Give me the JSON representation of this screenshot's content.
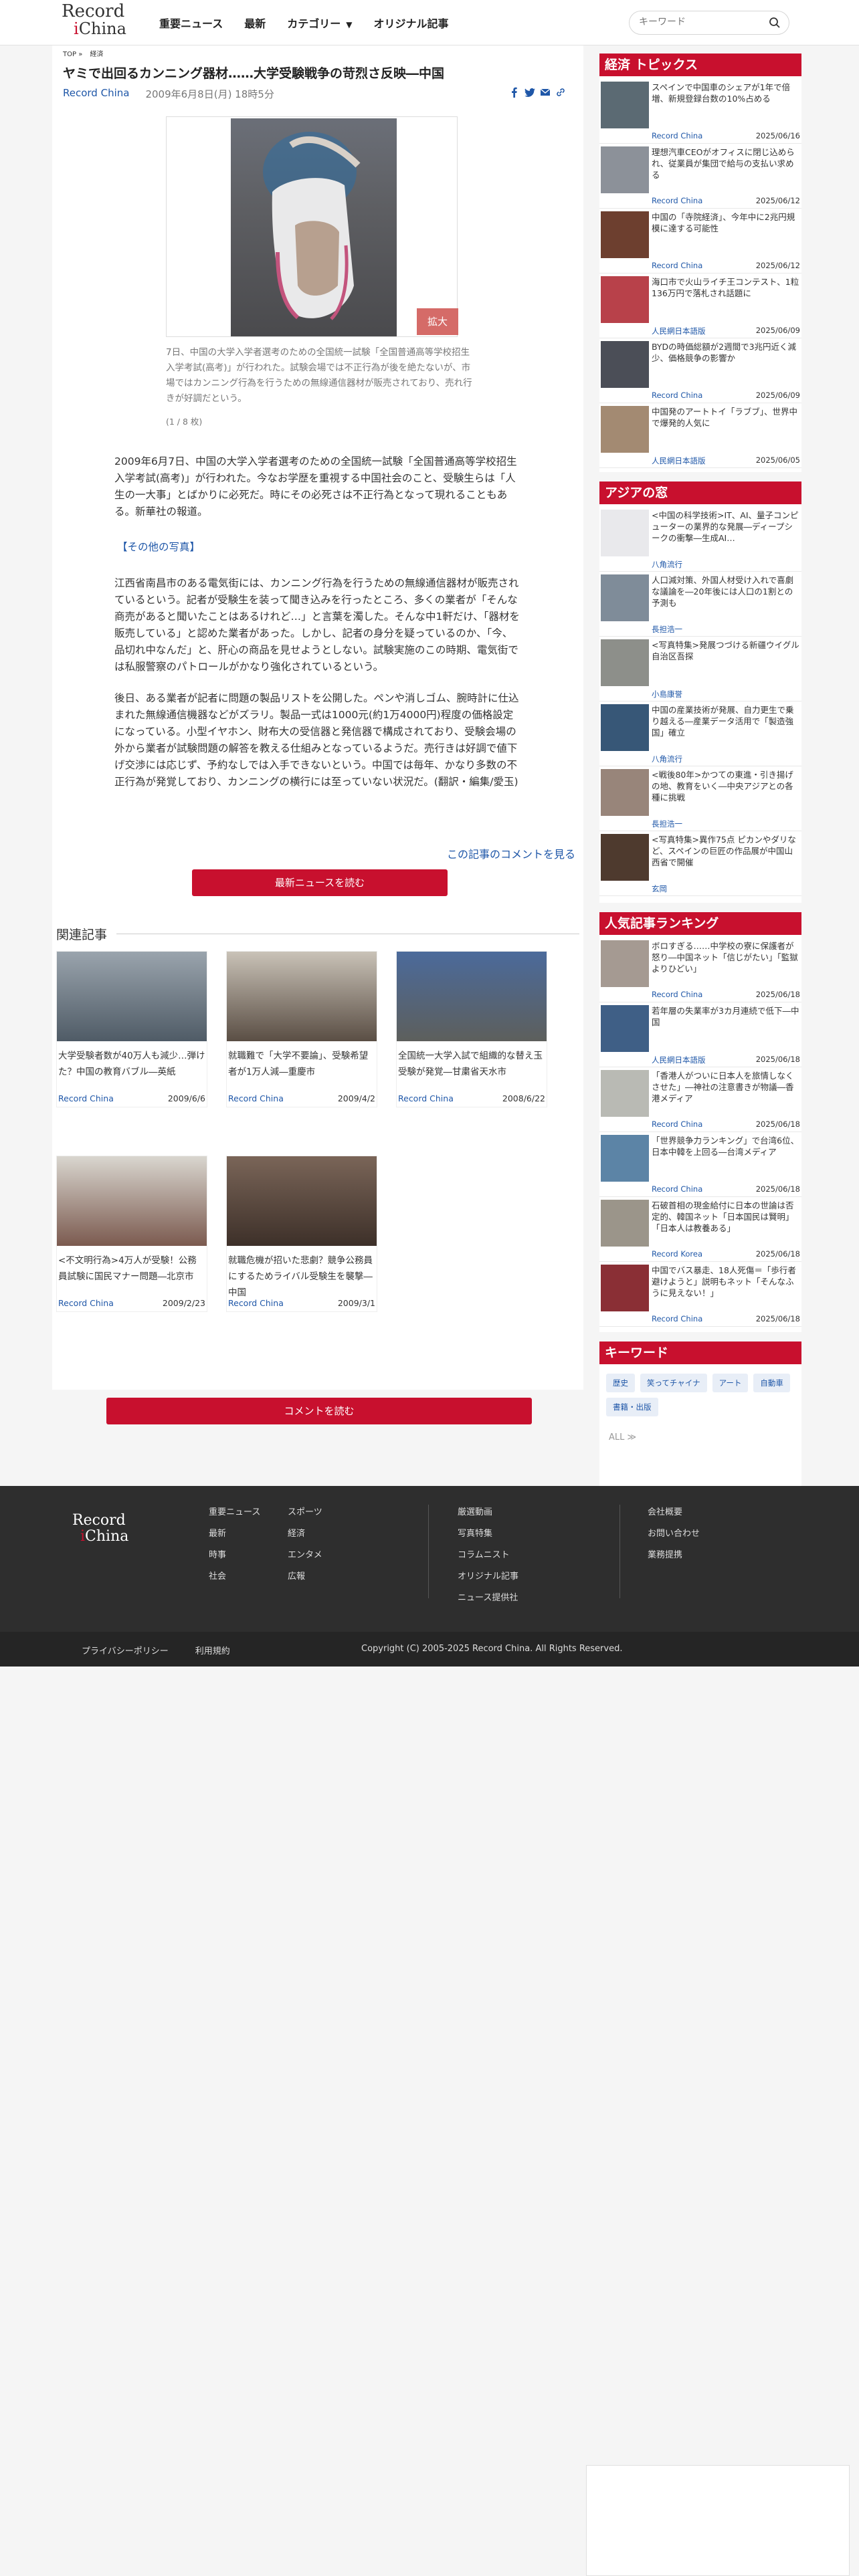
{
  "header": {
    "logo_line1": "Record",
    "logo_line2": "China",
    "nav": [
      "重要ニュース",
      "最新",
      "カテゴリー",
      "オリジナル記事"
    ],
    "search_placeholder": "キーワード"
  },
  "article": {
    "breadcrumb": [
      "TOP",
      "»",
      "経済"
    ],
    "title": "ヤミで出回るカンニング器材……大学受験戦争の苛烈さ反映―中国",
    "source": "Record China",
    "date": "2009年6月8日(月) 18時5分",
    "expand_label": "拡大",
    "caption": "7日、中国の大学入学者選考のための全国統一試験「全国普通高等学校招生入学考試(高考)」が行われた。試験会場では不正行為が後を絶たないが、市場ではカンニング行為を行うための無線通信器材が販売されており、売れ行きが好調だという。",
    "photo_count": "(1 / 8 枚)",
    "paragraph1": "2009年6月7日、中国の大学入学者選考のための全国統一試験「全国普通高等学校招生入学考試(高考)」が行われた。今なお学歴を重視する中国社会のこと、受験生らは「人生の一大事」とばかりに必死だ。時にその必死さは不正行為となって現れることもある。新華社の報道。",
    "photos_link": "【その他の写真】",
    "paragraph2": "江西省南昌市のある電気街には、カンニング行為を行うための無線通信器材が販売されているという。記者が受験生を装って聞き込みを行ったところ、多くの業者が「そんな商売があると聞いたことはあるけれど…」と言葉を濁した。そんな中1軒だけ、「器材を販売している」と認めた業者があった。しかし、記者の身分を疑っているのか、「今、品切れ中なんだ」と、肝心の商品を見せようとしない。試験実施のこの時期、電気街では私服警察のパトロールがかなり強化されているという。",
    "paragraph3": "後日、ある業者が記者に問題の製品リストを公開した。ペンや消しゴム、腕時計に仕込まれた無線通信機器などがズラリ。製品一式は1000元(約1万4000円)程度の価格設定になっている。小型イヤホン、財布大の受信器と発信器で構成されており、受験会場の外から業者が試験問題の解答を教える仕組みとなっているようだ。売行きは好調で値下げ交渉には応じず、予約なしでは入手できないという。中国では毎年、かなり多数の不正行為が発覚しており、カンニングの横行には至っていない状況だ。(翻訳・編集/愛玉)",
    "comment_link": "この記事のコメントを見る",
    "latest_button": "最新ニュースを読む"
  },
  "related": {
    "heading": "関連記事",
    "items": [
      {
        "title": "大学受験者数が40万人も減少…弾けた？中国の教育バブル―英紙",
        "source": "Record China",
        "date": "2009/6/6"
      },
      {
        "title": "就職難で「大学不要論」、受験希望者が1万人減―重慶市",
        "source": "Record China",
        "date": "2009/4/2"
      },
      {
        "title": "全国統一大学入試で組織的な替え玉受験が発覚―甘粛省天水市",
        "source": "Record China",
        "date": "2008/6/22"
      },
      {
        "title": "<不文明行為>4万人が受験！公務員試験に国民マナー問題―北京市",
        "source": "Record China",
        "date": "2009/2/23"
      },
      {
        "title": "就職危機が招いた悲劇？競争公務員にするためライバル受験生を襲撃―中国",
        "source": "Record China",
        "date": "2009/3/1"
      }
    ],
    "comment_button": "コメントを読む"
  },
  "sidebar": {
    "economy": {
      "heading": "経済 トピックス",
      "items": [
        {
          "title": "スペインで中国車のシェアが1年で倍増、新規登録台数の10%占める",
          "source": "Record China",
          "date": "2025/06/16"
        },
        {
          "title": "理想汽車CEOがオフィスに閉じ込められ、従業員が集団で給与の支払い求める",
          "source": "Record China",
          "date": "2025/06/12"
        },
        {
          "title": "中国の「寺院経済」、今年中に2兆円規模に達する可能性",
          "source": "Record China",
          "date": "2025/06/12"
        },
        {
          "title": "海口市で火山ライチ王コンテスト、1粒136万円で落札され話題に",
          "source": "人民網日本語版",
          "date": "2025/06/09"
        },
        {
          "title": "BYDの時価総額が2週間で3兆円近く減少、価格競争の影響か",
          "source": "Record China",
          "date": "2025/06/09"
        },
        {
          "title": "中国発のアートトイ「ラブブ」、世界中で爆発的人気に",
          "source": "人民網日本語版",
          "date": "2025/06/05"
        }
      ]
    },
    "asia": {
      "heading": "アジアの窓",
      "items": [
        {
          "title": "<中国の科学技術>IT、AI、量子コンピューターの業界的な発展―ディープシークの衝撃―生成AI…",
          "source": "八角流行"
        },
        {
          "title": "人口減対策、外国人材受け入れで喜劇な議論を―20年後には人口の1割との予測も",
          "source": "長担浩一"
        },
        {
          "title": "<写真特集>発展つづける新疆ウイグル自治区吾探",
          "source": "小島康誉"
        },
        {
          "title": "中国の産業技術が発展、自力更生で乗り越える―産業データ活用で「製造強国」確立",
          "source": "八角流行"
        },
        {
          "title": "<戦後80年>かつての東進・引き揚げの地、教育をいく―中央アジアとの各種に挑戦",
          "source": "長担浩一"
        },
        {
          "title": "<写真特集>異作75点 ピカンやダリなど、スペインの巨匠の作品展が中国山西省で開催",
          "source": "玄岡"
        }
      ]
    },
    "ranking": {
      "heading": "人気記事ランキング",
      "items": [
        {
          "title": "ボロすぎる……中学校の寮に保護者が怒り―中国ネット「信じがたい」「監獄よりひどい」",
          "source": "Record China",
          "date": "2025/06/18"
        },
        {
          "title": "若年層の失業率が3カ月連続で低下―中国",
          "source": "人民網日本語版",
          "date": "2025/06/18"
        },
        {
          "title": "「香港人がついに日本人を旅情しなくさせた」―神社の注意書きが物議―香港メディア",
          "source": "Record China",
          "date": "2025/06/18"
        },
        {
          "title": "「世界競争力ランキング」で台湾6位、日本中韓を上回る―台湾メディア",
          "source": "Record China",
          "date": "2025/06/18"
        },
        {
          "title": "石破首相の現金給付に日本の世論は否定的、韓国ネット「日本国民は賢明」「日本人は教養ある」",
          "source": "Record Korea",
          "date": "2025/06/18"
        },
        {
          "title": "中国でバス暴走、18人死傷＝「歩行者避けようと」説明もネット「そんなふうに見えない！」",
          "source": "Record China",
          "date": "2025/06/18"
        }
      ]
    },
    "keywords": {
      "heading": "キーワード",
      "tags": [
        "歴史",
        "笑ってチャイナ",
        "アート",
        "自動車",
        "書籍・出版"
      ],
      "all_label": "ALL ≫"
    }
  },
  "footer": {
    "logo_line1": "Record",
    "logo_line2": "China",
    "col1": [
      "重要ニュース",
      "最新",
      "時事",
      "社会"
    ],
    "col2": [
      "スポーツ",
      "経済",
      "エンタメ",
      "広報"
    ],
    "col3": [
      "厳選動画",
      "写真特集",
      "コラムニスト",
      "オリジナル記事",
      "ニュース提供社"
    ],
    "col4": [
      "会社概要",
      "お問い合わせ",
      "業務提携"
    ],
    "privacy": "プライバシーポリシー",
    "terms": "利用規約",
    "copyright": "Copyright (C) 2005-2025 Record China. All Rights Reserved."
  },
  "colors": {
    "accent": "#c8102e",
    "link": "#1f57a8",
    "footer": "#2e2e2e"
  }
}
